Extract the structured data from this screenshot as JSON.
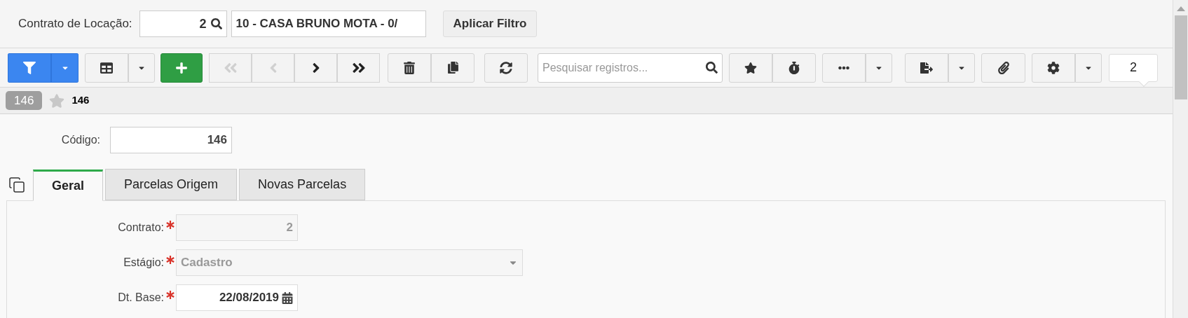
{
  "filter": {
    "label": "Contrato de Locação:",
    "value": "2",
    "description": "10 - CASA BRUNO MOTA - 0/",
    "apply_button": "Aplicar Filtro"
  },
  "toolbar": {
    "navigation": [
      {
        "disabled": true
      },
      {
        "disabled": true
      },
      {
        "disabled": false
      },
      {
        "disabled": false
      }
    ],
    "search": {
      "placeholder": "Pesquisar registros..."
    },
    "count": "2"
  },
  "record_bar": {
    "badge": "146",
    "favorite": false,
    "title": "146"
  },
  "code_field": {
    "label": "Código:",
    "value": "146"
  },
  "tabs": [
    {
      "label": "Geral",
      "selected": true
    },
    {
      "label": "Parcelas Origem",
      "selected": false
    },
    {
      "label": "Novas Parcelas",
      "selected": false
    }
  ],
  "fields": [
    {
      "kind": "text",
      "label": "Contrato:",
      "required": true,
      "disabled": true,
      "value": "2"
    },
    {
      "kind": "select",
      "label": "Estágio:",
      "required": true,
      "disabled": true,
      "value": "Cadastro"
    },
    {
      "kind": "date",
      "label": "Dt. Base:",
      "required": true,
      "disabled": false,
      "value": "22/08/2019"
    }
  ]
}
